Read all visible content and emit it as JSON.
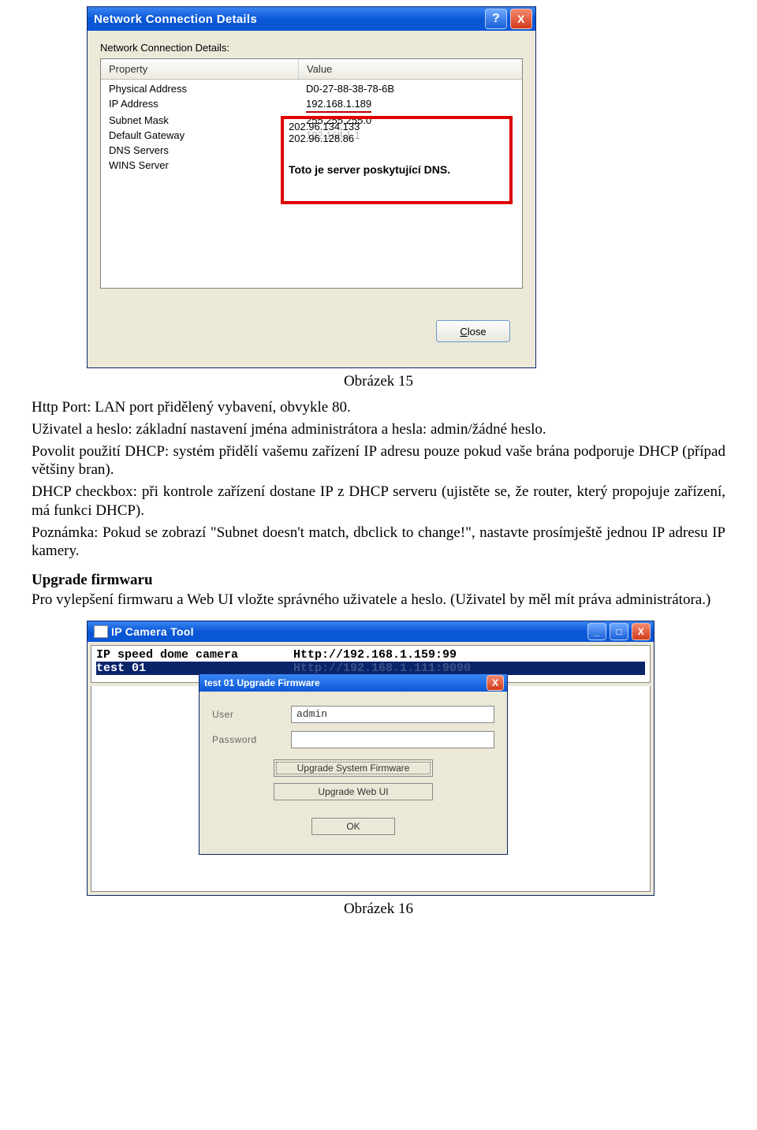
{
  "fig1": {
    "caption": "Obrázek 15",
    "window_title": "Network Connection Details",
    "dialog_label": "Network Connection Details:",
    "col_property": "Property",
    "col_value": "Value",
    "rows": {
      "phys_label": "Physical Address",
      "phys_value": "D0-27-88-38-78-6B",
      "ip_label": "IP Address",
      "ip_value": "192.168.1.189",
      "mask_label": "Subnet Mask",
      "mask_value": "255.255.255.0",
      "gw_label": "Default Gateway",
      "gw_value": "192.168.1.1",
      "dns_label": "DNS Servers",
      "dns_value1": "202.96.134.133",
      "dns_value2": "202.96.128.86",
      "wins_label": "WINS Server"
    },
    "callout_note": "Toto je server poskytující DNS.",
    "close_btn_pre": "",
    "close_btn_ul": "C",
    "close_btn_post": "lose",
    "help_glyph": "?",
    "x_glyph": "X"
  },
  "text": {
    "p1": "Http Port: LAN port přidělený vybavení, obvykle 80.",
    "p2": "Uživatel a heslo: základní nastavení jména administrátora a hesla: admin/žádné heslo.",
    "p3": "Povolit použití DHCP: systém přidělí vašemu zařízení IP adresu pouze pokud vaše brána podporuje DHCP (případ většiny bran).",
    "p4": "DHCP checkbox: při kontrole zařízení dostane IP z DHCP serveru (ujistěte se, že router, který propojuje zařízení, má funkci DHCP).",
    "p5": "Poznámka: Pokud se zobrazí \"Subnet doesn't match, dbclick to change!\", nastavte prosímještě jednou IP adresu IP kamery.",
    "heading": "Upgrade firmwaru",
    "p6": "Pro vylepšení firmwaru a Web UI vložte správného uživatele a heslo. (Uživatel by měl mít práva administrátora.)"
  },
  "fig2": {
    "tool_title": "IP Camera Tool",
    "row1_name": "IP speed dome camera",
    "row1_url": "Http://192.168.1.159:99",
    "row2_name": "test 01",
    "row2_url": "Http://192.168.1.111:9090",
    "dialog_title": "test 01 Upgrade Firmware",
    "user_label": "User",
    "password_label": "Password",
    "user_value": "admin",
    "btn_sys": "Upgrade System Firmware",
    "btn_web": "Upgrade Web UI",
    "btn_ok": "OK",
    "caption": "Obrázek 16",
    "min_glyph": "_",
    "max_glyph": "□",
    "x_glyph": "X"
  }
}
